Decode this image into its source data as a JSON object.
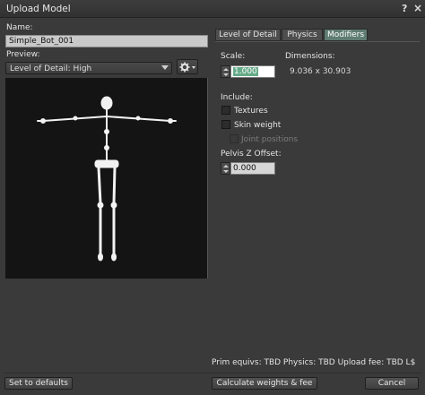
{
  "window": {
    "title": "Upload Model",
    "help_label": "?",
    "close_label": "×"
  },
  "name": {
    "label": "Name:",
    "value": "Simple_Bot_001"
  },
  "preview": {
    "label": "Preview:",
    "selected": "Level of Detail: High"
  },
  "tabs": [
    {
      "label": "Level of Detail",
      "active": false
    },
    {
      "label": "Physics",
      "active": false
    },
    {
      "label": "Modifiers",
      "active": true
    }
  ],
  "modifiers": {
    "scale_label": "Scale:",
    "scale_value_selected": "1.000",
    "dimensions_label": "Dimensions:",
    "dimensions_value": "9.036 x 30.903",
    "include_label": "Include:",
    "textures_label": "Textures",
    "textures_checked": false,
    "skin_weight_label": "Skin weight",
    "skin_weight_checked": false,
    "joint_positions_label": "Joint positions",
    "joint_positions_enabled": false,
    "pelvis_label": "Pelvis Z Offset:",
    "pelvis_value": "0.000"
  },
  "fees": {
    "text": "Prim equivs: TBD Physics: TBD Upload fee: TBD L$"
  },
  "buttons": {
    "set_defaults": "Set to defaults",
    "calculate": "Calculate weights & fee",
    "cancel": "Cancel"
  },
  "colors": {
    "active_tab": "#5f7d72",
    "selection": "#66aa88",
    "background": "#3a3a3a",
    "viewport": "#141414"
  }
}
